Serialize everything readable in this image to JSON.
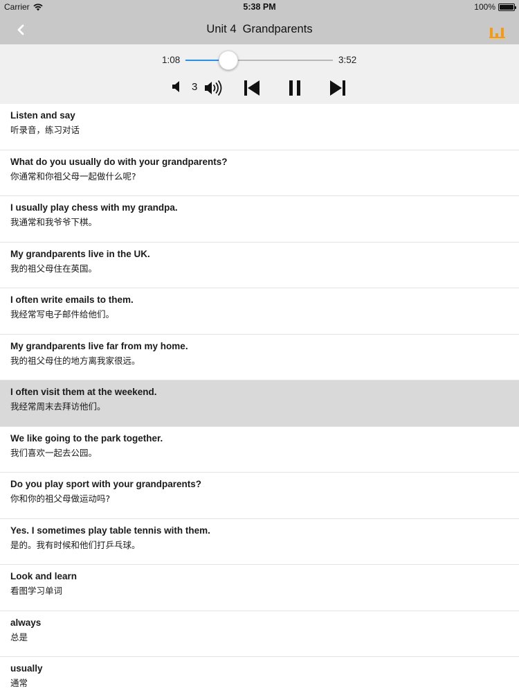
{
  "status_bar": {
    "carrier": "Carrier",
    "time": "5:38 PM",
    "battery": "100%"
  },
  "nav": {
    "title": "Unit 4  Grandparents",
    "back_icon": "chevron-left-icon",
    "menu_icon": "bar-chart-icon",
    "accent_color": "#f39c12"
  },
  "player": {
    "current_time": "1:08",
    "total_time": "3:52",
    "progress": 0.29,
    "speed": "3",
    "progress_color": "#1e90ff"
  },
  "items": [
    {
      "en": "Listen and say",
      "zh": "听录音，练习对话",
      "selected": false
    },
    {
      "en": "What do you usually do with your grandparents?",
      "zh": "你通常和你祖父母一起做什么呢?",
      "selected": false
    },
    {
      "en": "I usually play chess with my grandpa.",
      "zh": "我通常和我爷爷下棋。",
      "selected": false
    },
    {
      "en": "My grandparents live in the UK.",
      "zh": "我的祖父母住在英国。",
      "selected": false
    },
    {
      "en": "I often write emails to them.",
      "zh": "我经常写电子邮件给他们。",
      "selected": false
    },
    {
      "en": "My grandparents live far from my home.",
      "zh": "我的祖父母住的地方离我家很远。",
      "selected": false
    },
    {
      "en": "I often visit them at the weekend.",
      "zh": "我经常周末去拜访他们。",
      "selected": true
    },
    {
      "en": "We like going to the park together.",
      "zh": "我们喜欢一起去公园。",
      "selected": false
    },
    {
      "en": "Do you play sport with your grandparents?",
      "zh": "你和你的祖父母做运动吗?",
      "selected": false
    },
    {
      "en": "Yes. I sometimes play table tennis with them.",
      "zh": "是的。我有时候和他们打乒乓球。",
      "selected": false
    },
    {
      "en": "Look and learn",
      "zh": "看图学习单词",
      "selected": false
    },
    {
      "en": "always",
      "zh": "总是",
      "selected": false
    },
    {
      "en": "usually",
      "zh": "通常",
      "selected": false
    }
  ]
}
